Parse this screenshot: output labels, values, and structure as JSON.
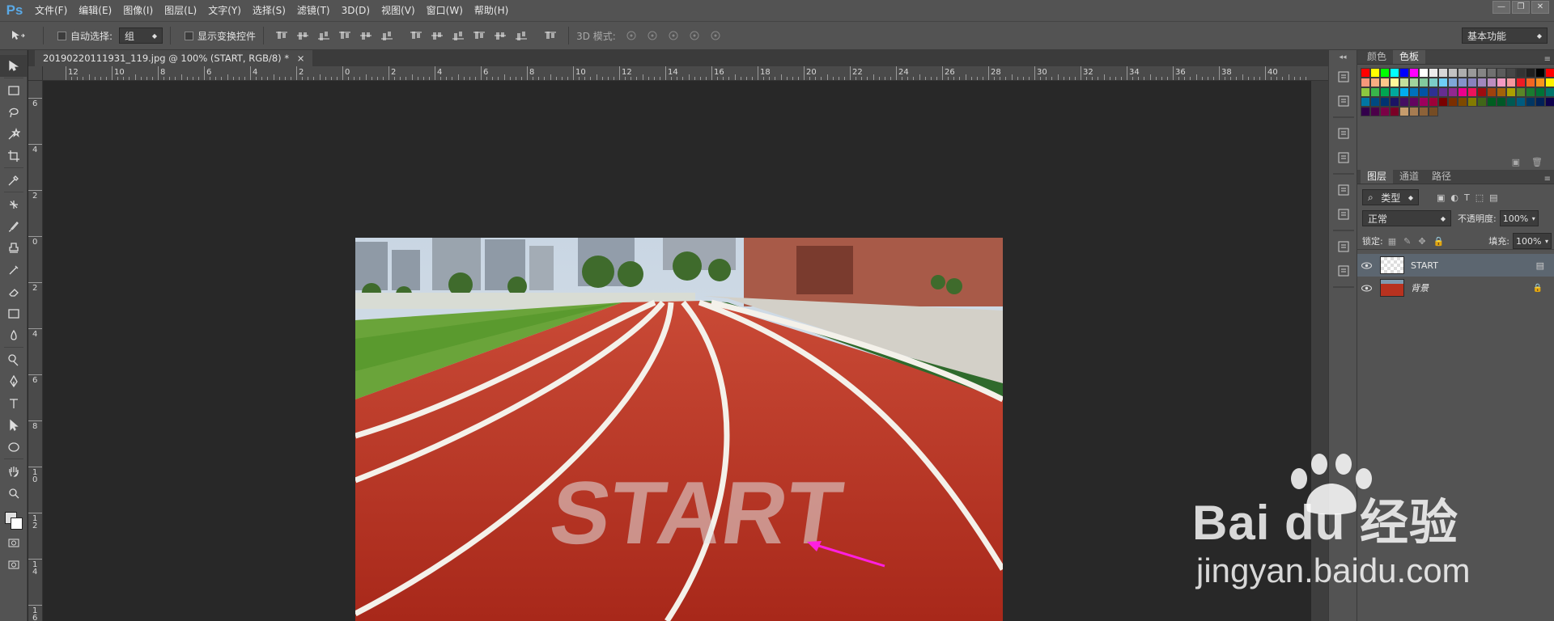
{
  "app": {
    "logo": "Ps"
  },
  "menu": [
    "文件(F)",
    "编辑(E)",
    "图像(I)",
    "图层(L)",
    "文字(Y)",
    "选择(S)",
    "滤镜(T)",
    "3D(D)",
    "视图(V)",
    "窗口(W)",
    "帮助(H)"
  ],
  "window_controls": [
    "—",
    "❐",
    "✕"
  ],
  "options_bar": {
    "auto_select_label": "自动选择:",
    "auto_select_value": "组",
    "show_transform_label": "显示变换控件",
    "mode_3d_label": "3D 模式:",
    "workspace": "基本功能"
  },
  "document": {
    "tab_title": "20190220111931_119.jpg @ 100% (START, RGB/8) *",
    "close_glyph": "×"
  },
  "ruler_top": [
    "12",
    "10",
    "8",
    "6",
    "4",
    "2",
    "0",
    "2",
    "4",
    "6",
    "8",
    "10",
    "12",
    "14",
    "16",
    "18",
    "20",
    "22",
    "24",
    "26",
    "28",
    "30",
    "32",
    "34",
    "36",
    "38",
    "40"
  ],
  "ruler_left": [
    "6",
    "4",
    "2",
    "0",
    "2",
    "4",
    "6",
    "8",
    "10",
    "12",
    "14",
    "16"
  ],
  "canvas_text": {
    "start_paint": "START"
  },
  "panels": {
    "color_tabs": [
      "颜色",
      "色板"
    ],
    "layer_tabs": [
      "图层",
      "通道",
      "路径"
    ],
    "filter_kind": "类型",
    "blend_mode": "正常",
    "opacity_label": "不透明度:",
    "opacity_value": "100%",
    "lock_label": "锁定:",
    "fill_label": "填充:",
    "fill_value": "100%",
    "layers": [
      {
        "name": "START"
      },
      {
        "name": "背景"
      }
    ]
  },
  "watermark": {
    "brand": "Bai du 经验",
    "url": "jingyan.baidu.com"
  },
  "colors": {
    "accent_arrow": "#ff1fe0",
    "track": "#b8321f",
    "ui_bg": "#535353"
  }
}
